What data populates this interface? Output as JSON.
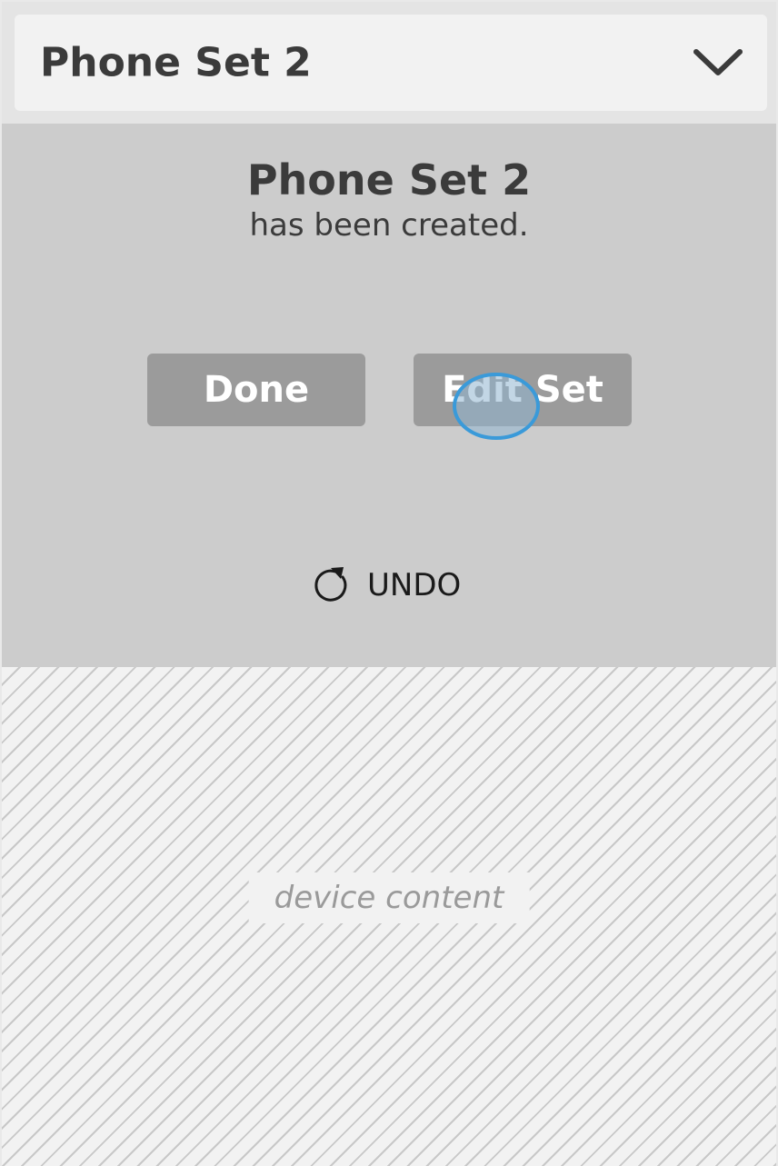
{
  "dropdown": {
    "selected": "Phone Set 2"
  },
  "confirmation": {
    "title": "Phone Set 2",
    "subtitle": "has been created."
  },
  "actions": {
    "done_label": "Done",
    "edit_label": "Edit Set"
  },
  "undo": {
    "label": "UNDO",
    "icon": "undo-icon"
  },
  "device": {
    "placeholder": "device content"
  },
  "colors": {
    "button_bg": "#9b9b9b",
    "panel_bg": "#cccccc",
    "touch_indicator": "#3a9ad9"
  }
}
